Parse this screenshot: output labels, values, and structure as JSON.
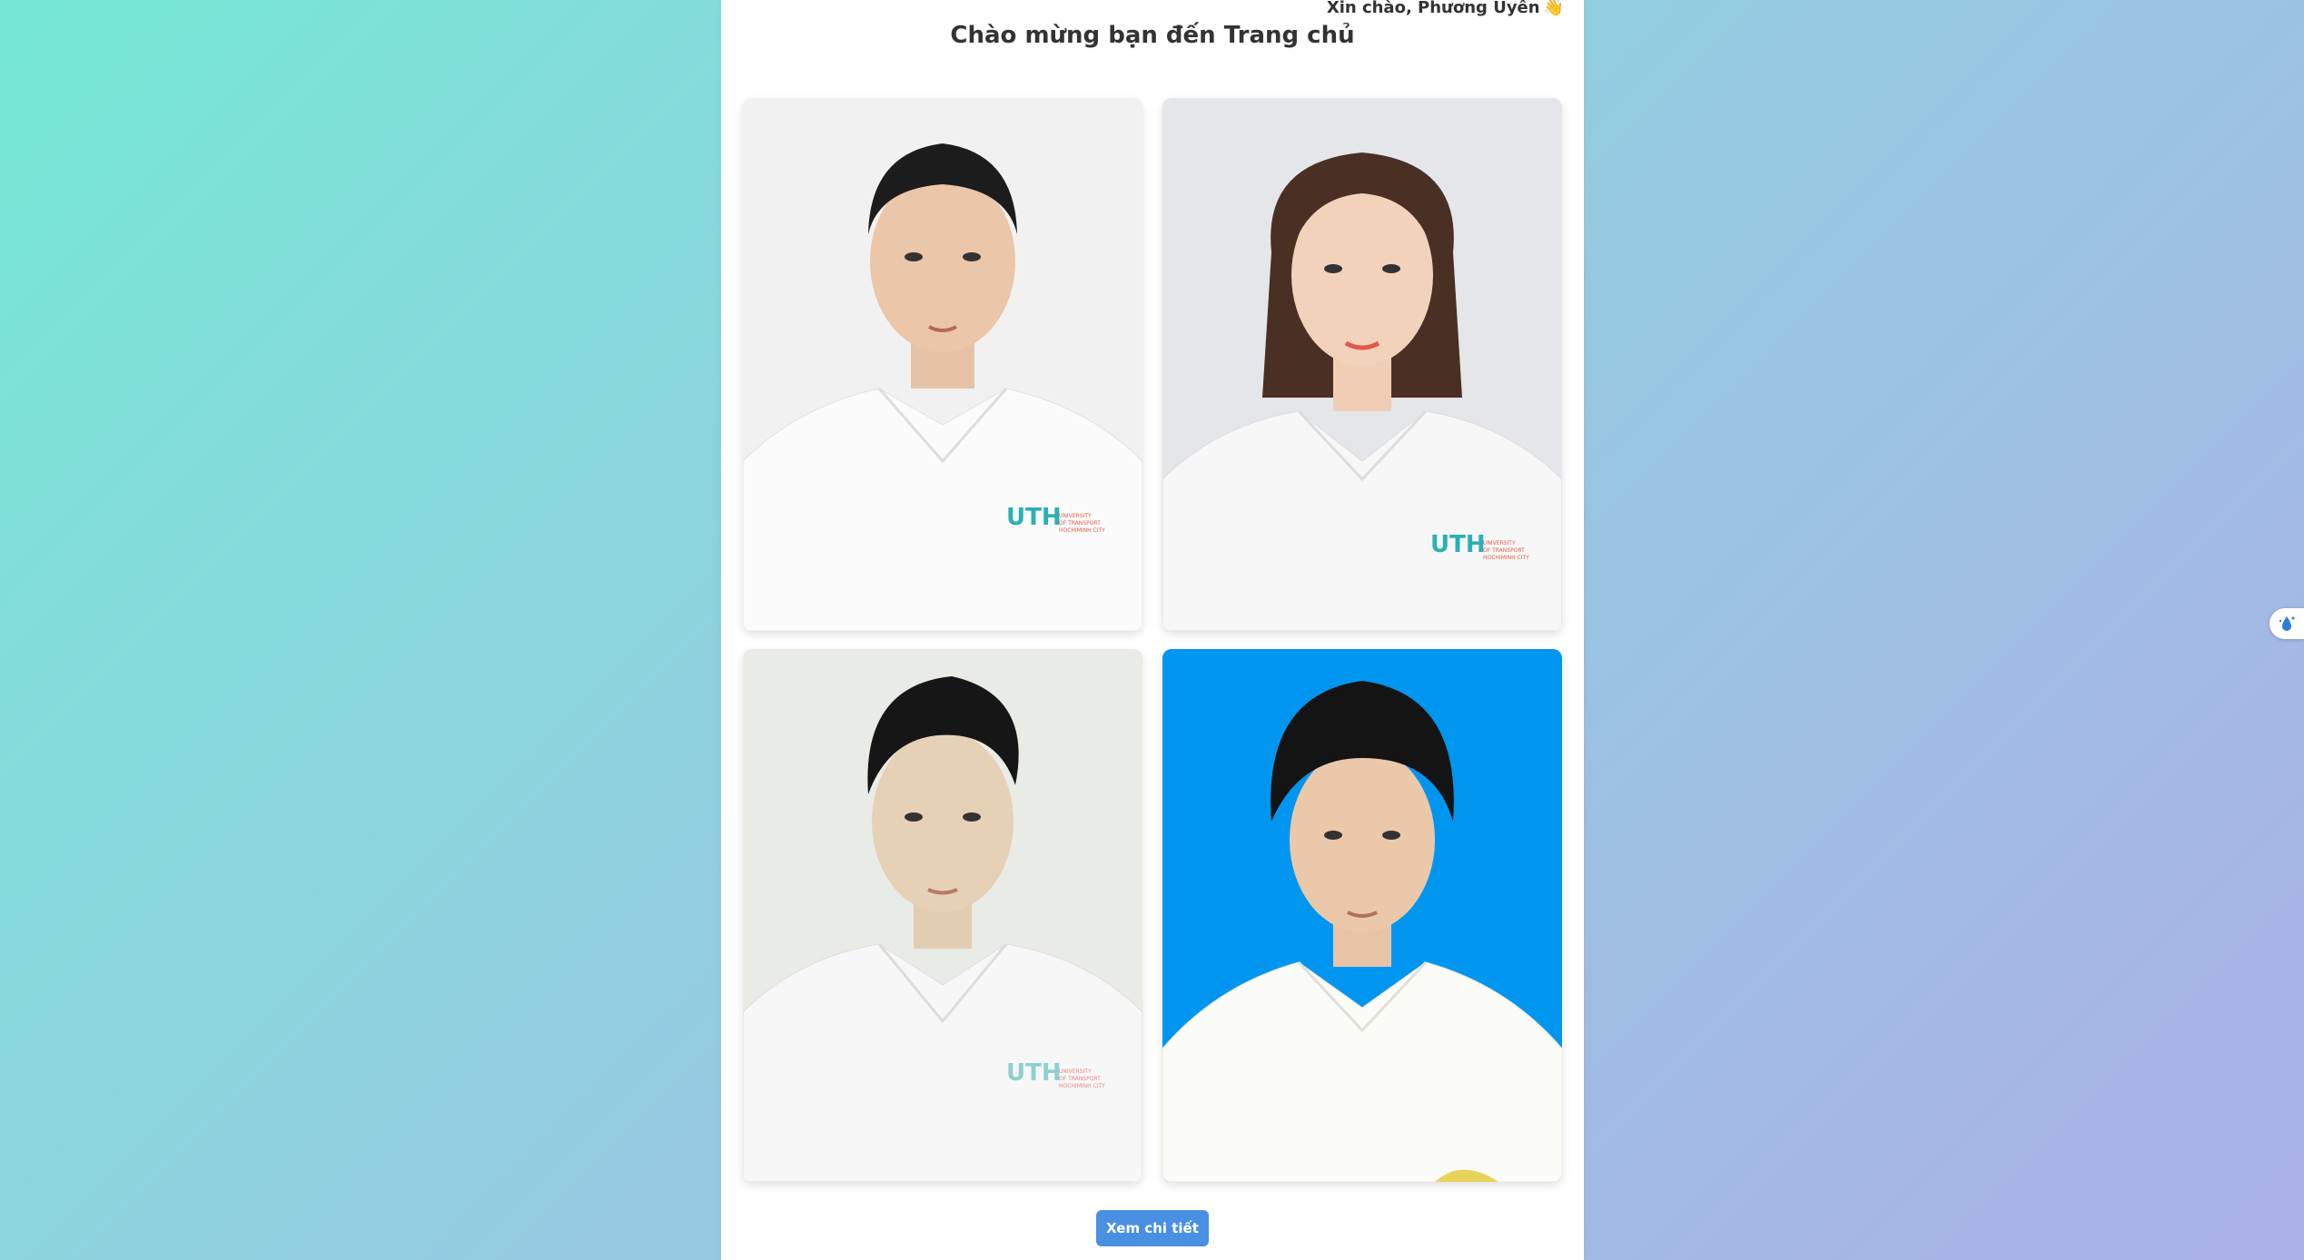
{
  "header": {
    "greeting": "Xin chào, Phương Uyên",
    "greeting_icon": "waving-hand-icon",
    "title": "Chào mừng bạn đến Trang chủ"
  },
  "photos": [
    {
      "name": "portrait-1",
      "background": "#f1f1f1",
      "logo": "UTH UNIVERSITY OF TRANSPORT HOCHIMINH CITY"
    },
    {
      "name": "portrait-2",
      "background": "#e4e6ea",
      "logo": "UTH UNIVERSITY OF TRANSPORT HOCHIMINH CITY"
    },
    {
      "name": "portrait-3",
      "background": "#e9ebe6",
      "logo": "UTH UNIVERSITY OF TRANSPORT HOCHIMINH CITY"
    },
    {
      "name": "portrait-4",
      "background": "#0096f0",
      "logo": ""
    }
  ],
  "actions": {
    "detail_label": "Xem chi tiết"
  },
  "colors": {
    "accent": "#4a90e2",
    "panel": "#ffffff"
  },
  "side_widget": {
    "icon": "water-drop-icon"
  }
}
